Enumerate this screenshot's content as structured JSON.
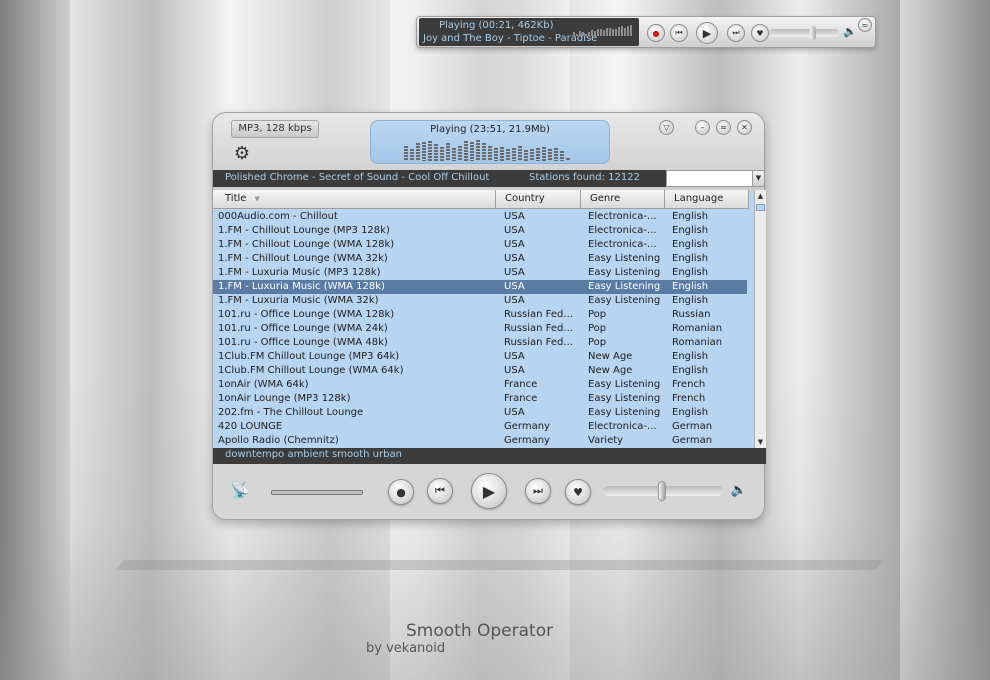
{
  "mini_player": {
    "status": "Playing (00:21, 462Kb)",
    "track": "Joy and The Boy - Tiptoe - Paradise",
    "viz_levels": [
      0.3,
      0.2,
      0.4,
      0.3,
      0.2,
      0.35,
      0.5,
      0.45,
      0.55,
      0.6,
      0.5,
      0.65,
      0.7,
      0.55,
      0.6,
      0.75,
      0.8,
      0.7,
      0.85,
      0.9
    ]
  },
  "main": {
    "bitrate": "MP3, 128 kbps",
    "status": "Playing (23:51, 21.9Mb)",
    "viz_levels": [
      0.7,
      0.55,
      0.8,
      0.85,
      0.9,
      0.75,
      0.65,
      0.8,
      0.6,
      0.7,
      0.9,
      0.85,
      0.95,
      0.8,
      0.7,
      0.6,
      0.65,
      0.55,
      0.6,
      0.7,
      0.5,
      0.55,
      0.6,
      0.65,
      0.55,
      0.6,
      0.45,
      0.15
    ],
    "current_track": "Polished Chrome - Secret of Sound - Cool Off Chillout",
    "stations_found": "Stations found: 12122",
    "tags": "downtempo ambient smooth urban",
    "progress": 1.0,
    "volume": 0.58
  },
  "table": {
    "columns": [
      "Title",
      "Country",
      "Genre",
      "Language"
    ],
    "rows": [
      {
        "title": "000Audio.com - Chillout",
        "country": "USA",
        "genre": "Electronica-...",
        "language": "English"
      },
      {
        "title": "1.FM - Chillout Lounge (MP3 128k)",
        "country": "USA",
        "genre": "Electronica-...",
        "language": "English"
      },
      {
        "title": "1.FM - Chillout Lounge (WMA 128k)",
        "country": "USA",
        "genre": "Electronica-...",
        "language": "English"
      },
      {
        "title": "1.FM - Chillout Lounge (WMA 32k)",
        "country": "USA",
        "genre": "Easy Listening",
        "language": "English"
      },
      {
        "title": "1.FM - Luxuria Music (MP3 128k)",
        "country": "USA",
        "genre": "Easy Listening",
        "language": "English"
      },
      {
        "title": "1.FM - Luxuria Music (WMA 128k)",
        "country": "USA",
        "genre": "Easy Listening",
        "language": "English",
        "selected": true
      },
      {
        "title": "1.FM - Luxuria Music (WMA 32k)",
        "country": "USA",
        "genre": "Easy Listening",
        "language": "English"
      },
      {
        "title": "101.ru - Office Lounge (WMA 128k)",
        "country": "Russian Fed...",
        "genre": "Pop",
        "language": "Russian"
      },
      {
        "title": "101.ru - Office Lounge (WMA 24k)",
        "country": "Russian Fed...",
        "genre": "Pop",
        "language": "Romanian"
      },
      {
        "title": "101.ru - Office Lounge (WMA 48k)",
        "country": "Russian Fed...",
        "genre": "Pop",
        "language": "Romanian"
      },
      {
        "title": "1Club.FM Chillout Lounge (MP3 64k)",
        "country": "USA",
        "genre": "New Age",
        "language": "English"
      },
      {
        "title": "1Club.FM Chillout Lounge (WMA 64k)",
        "country": "USA",
        "genre": "New Age",
        "language": "English"
      },
      {
        "title": "1onAir (WMA 64k)",
        "country": "France",
        "genre": "Easy Listening",
        "language": "French"
      },
      {
        "title": "1onAir Lounge (MP3 128k)",
        "country": "France",
        "genre": "Easy Listening",
        "language": "French"
      },
      {
        "title": "202.fm - The Chillout Lounge",
        "country": "USA",
        "genre": "Easy Listening",
        "language": "English"
      },
      {
        "title": "420 LOUNGE",
        "country": "Germany",
        "genre": "Electronica-...",
        "language": "German"
      },
      {
        "title": "Apollo Radio (Chemnitz)",
        "country": "Germany",
        "genre": "Variety",
        "language": "German"
      }
    ]
  },
  "icons": {
    "record": "●",
    "prev": "⏮",
    "play": "▶",
    "next": "⏭",
    "heart": "♥",
    "speaker": "🔈",
    "gear": "⚙",
    "antenna": "📡",
    "down": "▽",
    "minimize": "–",
    "link": "≈",
    "close": "✕",
    "sort": "▼",
    "scroll_up": "▲",
    "scroll_down": "▼",
    "dropdown": "▼"
  },
  "colors": {
    "display_text": "#a9cde9",
    "table_bg": "#b7d4f0",
    "selected_row": "#5a7ca4",
    "record": "#d01818"
  },
  "credits": {
    "title": "Smooth Operator",
    "author": "by vekanoid"
  }
}
